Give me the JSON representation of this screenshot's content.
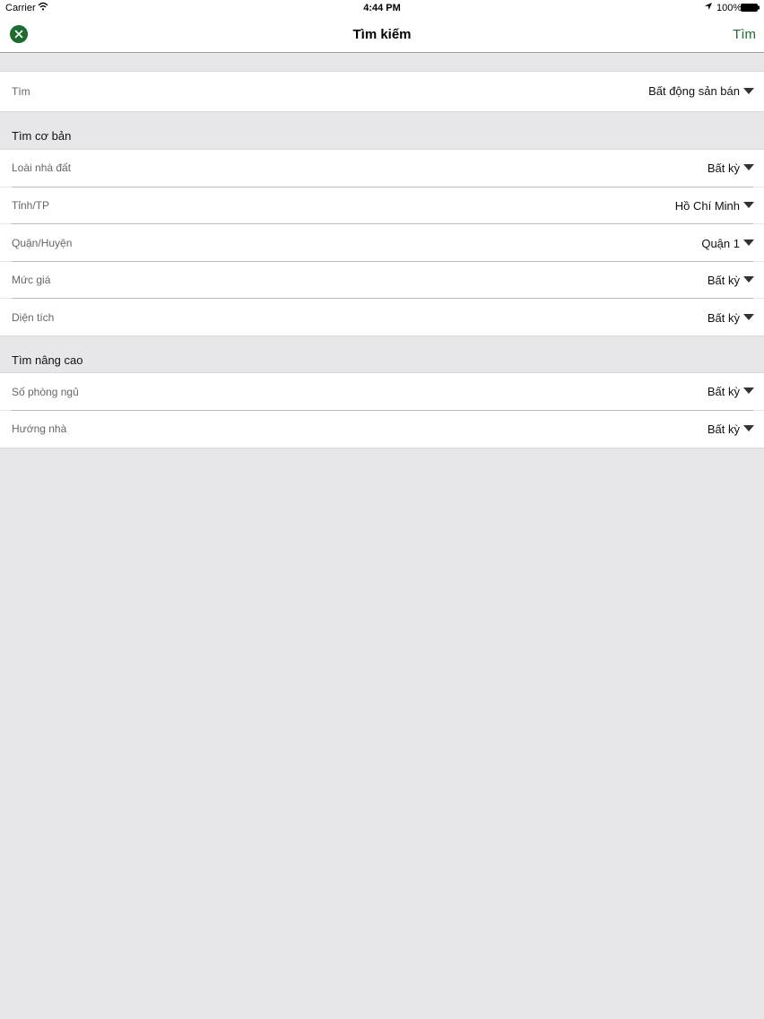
{
  "status_bar": {
    "carrier": "Carrier",
    "time": "4:44 PM",
    "battery": "100%"
  },
  "nav": {
    "title": "Tìm kiếm",
    "action_label": "Tìm",
    "close_icon": "close-circle-icon",
    "accent_color": "#1b6c2d"
  },
  "search_type": {
    "label": "Tìm",
    "value": "Bất động sản bán"
  },
  "basic": {
    "header": "Tìm cơ bản",
    "items": [
      {
        "label": "Loài nhà đất",
        "value": "Bất kỳ"
      },
      {
        "label": "Tỉnh/TP",
        "value": "Hồ Chí Minh"
      },
      {
        "label": "Quận/Huyện",
        "value": "Quận 1"
      },
      {
        "label": "Mức giá",
        "value": "Bất kỳ"
      },
      {
        "label": "Diện tích",
        "value": "Bất kỳ"
      }
    ]
  },
  "advanced": {
    "header": "Tìm nâng cao",
    "items": [
      {
        "label": "Số phòng ngủ",
        "value": "Bất kỳ"
      },
      {
        "label": "Hướng nhà",
        "value": "Bất kỳ"
      }
    ]
  }
}
